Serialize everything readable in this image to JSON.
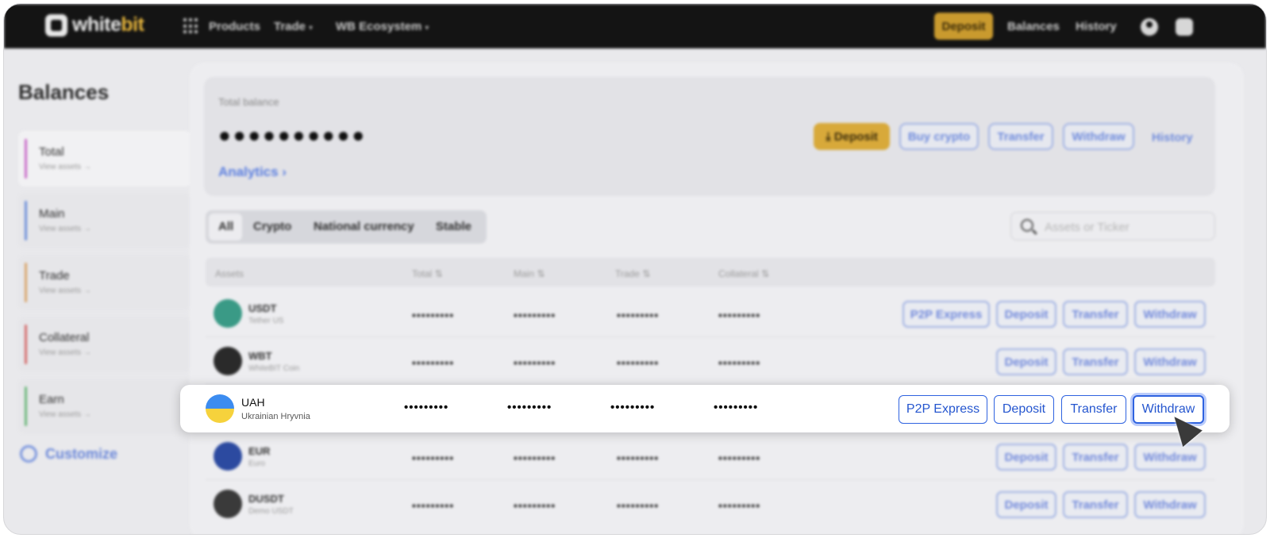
{
  "topbar": {
    "logo_prefix": "white",
    "logo_accent": "bit",
    "nav": [
      "Products",
      "Trade",
      "WB Ecosystem"
    ],
    "deposit_label": "Deposit",
    "balances_label": "Balances",
    "history_label": "History"
  },
  "sidebar": {
    "title": "Balances",
    "items": [
      {
        "label": "Total",
        "sub": "View assets →",
        "color": "#c86ac8"
      },
      {
        "label": "Main",
        "sub": "View assets →",
        "color": "#6d8fd8"
      },
      {
        "label": "Trade",
        "sub": "View assets →",
        "color": "#d9a46a"
      },
      {
        "label": "Collateral",
        "sub": "View assets →",
        "color": "#d36a6a"
      },
      {
        "label": "Earn",
        "sub": "View assets →",
        "color": "#6ab77a"
      }
    ],
    "customize_label": "Customize"
  },
  "balance_card": {
    "label": "Total balance",
    "value": "●●●●●●●●●●",
    "analytics_label": "Analytics  ›",
    "buttons": [
      "⤓ Deposit",
      "Buy crypto",
      "Transfer",
      "Withdraw"
    ],
    "history_label": "History"
  },
  "filters": {
    "tabs": [
      "All",
      "Crypto",
      "National currency",
      "Stable"
    ],
    "search_placeholder": "Assets or Ticker"
  },
  "table": {
    "headers": [
      "Assets",
      "Total ⇅",
      "Main ⇅",
      "Trade ⇅",
      "Collateral ⇅"
    ],
    "hidden_value": "•••••••••",
    "rows": [
      {
        "ticker": "USDT",
        "name": "Tether US",
        "coin_color": "#3a9a86",
        "buttons": [
          "P2P Express",
          "Deposit",
          "Transfer",
          "Withdraw"
        ]
      },
      {
        "ticker": "WBT",
        "name": "WhiteBIT Coin",
        "coin_color": "#2a2a2a",
        "buttons": [
          "Deposit",
          "Transfer",
          "Withdraw"
        ]
      },
      {
        "ticker": "EUR",
        "name": "Euro",
        "coin_color": "#2c4aa0",
        "buttons": [
          "Deposit",
          "Transfer",
          "Withdraw"
        ]
      },
      {
        "ticker": "DUSDT",
        "name": "Demo USDT",
        "coin_color": "#3a3a3a",
        "buttons": [
          "Deposit",
          "Transfer",
          "Withdraw"
        ]
      }
    ]
  },
  "highlight_row": {
    "ticker": "UAH",
    "name": "Ukrainian Hryvnia",
    "buttons": [
      "P2P Express",
      "Deposit",
      "Transfer",
      "Withdraw"
    ]
  }
}
